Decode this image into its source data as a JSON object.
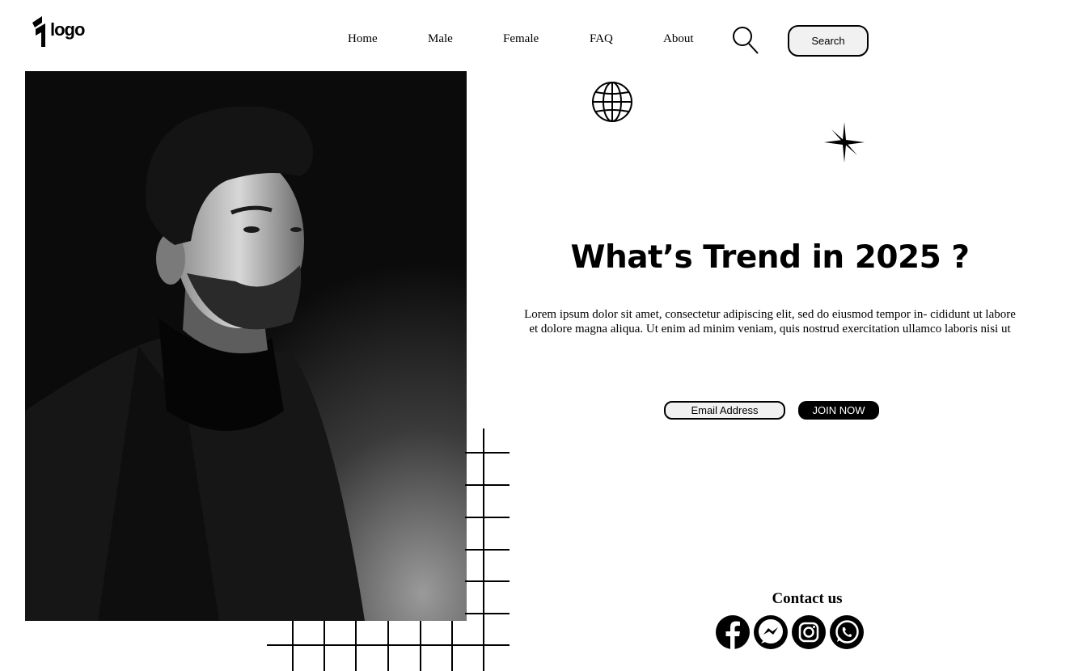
{
  "header": {
    "logo_text": "logo",
    "nav": [
      "Home",
      "Male",
      "Female",
      "FAQ",
      "About"
    ],
    "search_button": "Search"
  },
  "hero": {
    "headline": "What’s Trend in 2025 ?",
    "paragraph": "Lorem ipsum dolor sit amet, consectetur adipiscing elit, sed do eiusmod tempor in- cididunt ut labore et dolore magna aliqua. Ut enim ad minim veniam, quis nostrud exercitation ullamco laboris nisi ut",
    "email_placeholder": "Email Address",
    "join_label": "JOIN NOW"
  },
  "contact": {
    "title": "Contact us",
    "icons": [
      "facebook-icon",
      "messenger-icon",
      "instagram-icon",
      "whatsapp-icon"
    ]
  }
}
